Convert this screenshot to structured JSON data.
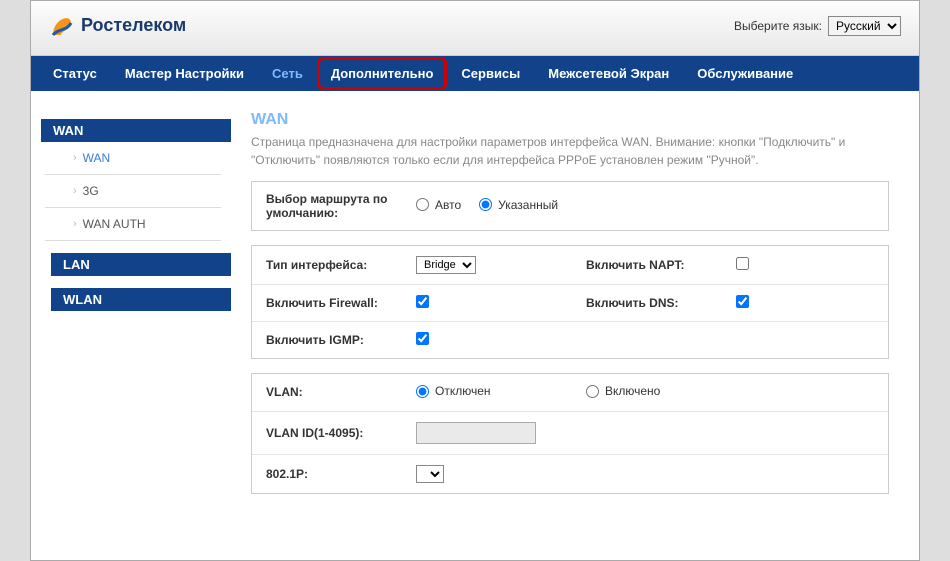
{
  "lang": {
    "label": "Выберите язык:",
    "selected": "Русский",
    "options": [
      "Русский"
    ]
  },
  "logo": {
    "text": "Ростелеком"
  },
  "nav": {
    "items": [
      {
        "label": "Статус",
        "name": "nav-status"
      },
      {
        "label": "Мастер Настройки",
        "name": "nav-wizard"
      },
      {
        "label": "Сеть",
        "name": "nav-network",
        "active": true
      },
      {
        "label": "Дополнительно",
        "name": "nav-advanced",
        "highlight": true
      },
      {
        "label": "Сервисы",
        "name": "nav-services"
      },
      {
        "label": "Межсетевой Экран",
        "name": "nav-firewall"
      },
      {
        "label": "Обслуживание",
        "name": "nav-maintenance"
      }
    ]
  },
  "sidebar": {
    "groups": [
      {
        "head": "WAN",
        "items": [
          {
            "label": "WAN",
            "active": true
          },
          {
            "label": "3G"
          },
          {
            "label": "WAN AUTH"
          }
        ]
      },
      {
        "head": "LAN",
        "items": []
      },
      {
        "head": "WLAN",
        "items": []
      }
    ]
  },
  "main": {
    "title": "WAN",
    "desc": "Страница предназначена для настройки параметров интерфейса WAN. Внимание: кнопки \"Подключить\" и \"Отключить\" появляются только если для интерфейса PPPoE установлен режим \"Ручной\".",
    "route": {
      "label": "Выбор маршрута по умолчанию:",
      "opt_auto": "Авто",
      "opt_spec": "Указанный",
      "value": "spec"
    },
    "iface": {
      "type_label": "Тип интерфейса:",
      "type_value": "Bridge",
      "type_options": [
        "Bridge"
      ],
      "napt_label": "Включить NAPT:",
      "napt_checked": false,
      "fw_label": "Включить Firewall:",
      "fw_checked": true,
      "dns_label": "Включить DNS:",
      "dns_checked": true,
      "igmp_label": "Включить IGMP:",
      "igmp_checked": true
    },
    "vlan": {
      "vlan_label": "VLAN:",
      "opt_off": "Отключен",
      "opt_on": "Включено",
      "value": "off",
      "id_label": "VLAN ID(1-4095):",
      "id_value": "",
      "p_label": "802.1P:",
      "p_value": "",
      "p_options": [
        ""
      ]
    }
  }
}
